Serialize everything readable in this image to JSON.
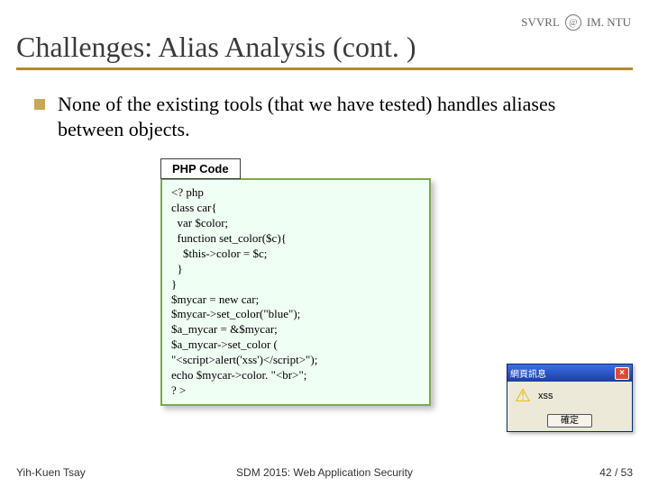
{
  "header": {
    "left_abbr": "SVVRL",
    "right_abbr": "IM. NTU"
  },
  "title": "Challenges: Alias Analysis (cont. )",
  "bullet": "None of the existing tools (that we have tested) handles aliases between objects.",
  "code": {
    "tab_label": "PHP Code",
    "lines": [
      "<? php",
      "class car{",
      "  var $color;",
      "  function set_color($c){",
      "    $this->color = $c;",
      "  }",
      "}",
      "$mycar = new car;",
      "$mycar->set_color(\"blue\");",
      "$a_mycar = &$mycar;",
      "$a_mycar->set_color (",
      "\"<script>alert('xss')</script>\");",
      "echo $mycar->color. \"<br>\";",
      "? >"
    ]
  },
  "alert": {
    "title": "網頁訊息",
    "message": "xss",
    "ok_label": "確定"
  },
  "footer": {
    "author": "Yih-Kuen Tsay",
    "venue": "SDM 2015: Web Application Security",
    "page": "42 / 53"
  }
}
